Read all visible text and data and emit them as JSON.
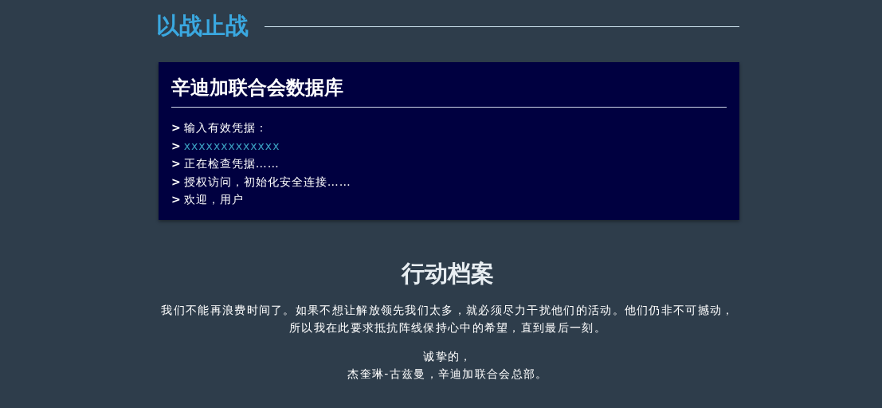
{
  "banner": {
    "title": "以战止战"
  },
  "terminal": {
    "title": "辛迪加联合会数据库",
    "lines": [
      {
        "prompt": ">",
        "text": "输入有效凭据：",
        "kind": "output"
      },
      {
        "prompt": ">",
        "text": "xxxxxxxxxxxxx",
        "kind": "input"
      },
      {
        "prompt": ">",
        "text": "正在检查凭据……",
        "kind": "output"
      },
      {
        "prompt": ">",
        "text": "授权访问，初始化安全连接……",
        "kind": "output"
      },
      {
        "prompt": ">",
        "text": "欢迎，用户",
        "kind": "output"
      }
    ]
  },
  "dossier": {
    "title": "行动档案",
    "body": "我们不能再浪费时间了。如果不想让解放领先我们太多，就必须尽力干扰他们的活动。他们仍非不可撼动，所以我在此要求抵抗阵线保持心中的希望，直到最后一刻。",
    "closing": "诚挚的，",
    "signature": "杰奎琳-古兹曼，辛迪加联合会总部。"
  }
}
